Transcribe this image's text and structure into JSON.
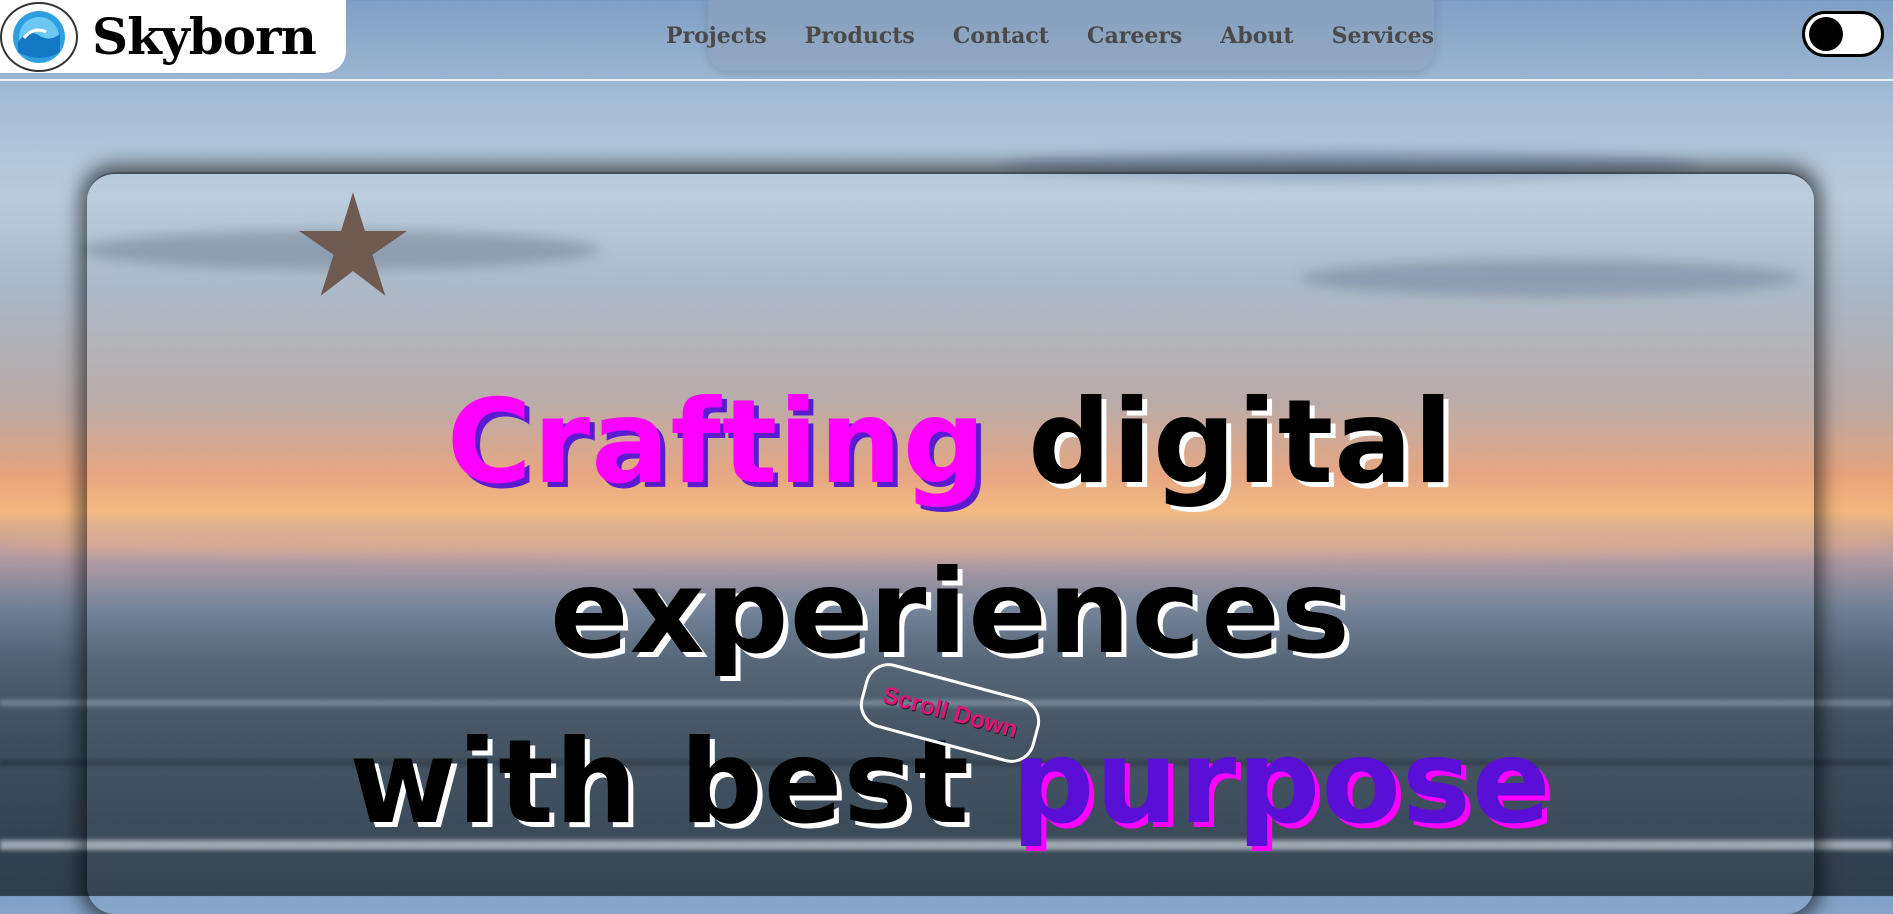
{
  "brand": {
    "name": "Skyborn"
  },
  "nav": {
    "items": [
      {
        "label": "Projects"
      },
      {
        "label": "Products"
      },
      {
        "label": "Contact"
      },
      {
        "label": "Careers"
      },
      {
        "label": "About"
      },
      {
        "label": "Services"
      }
    ]
  },
  "theme_toggle": {
    "state": "off"
  },
  "hero": {
    "word1": "Crafting",
    "rest1": "digital experiences",
    "line2_lead": "with best",
    "word2": "purpose",
    "scroll_label": "Scroll Down"
  },
  "colors": {
    "accent_pink": "#ff00ff",
    "accent_purple": "#5a0fd6",
    "star": "#6e5a50",
    "scroll_text": "#e0147a"
  },
  "icons": {
    "logo": "wave-globe-icon",
    "decoration": "star-icon"
  }
}
